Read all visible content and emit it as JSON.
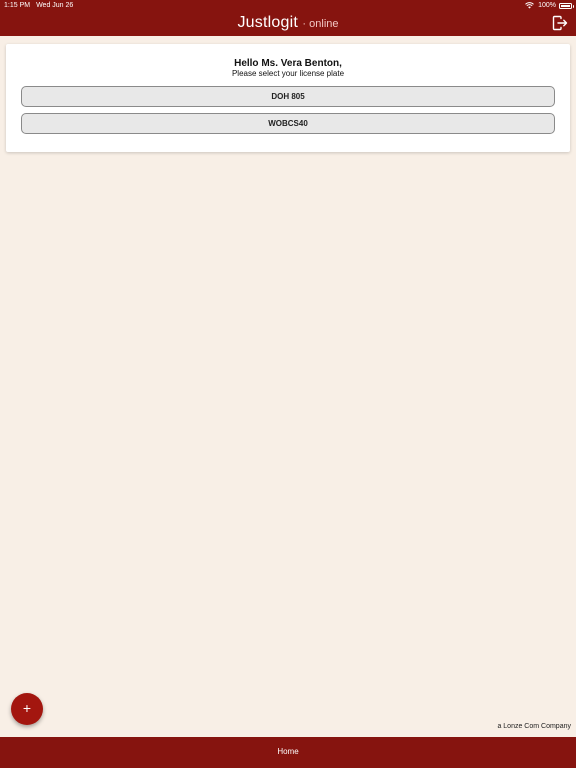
{
  "status_bar": {
    "time": "1:15 PM",
    "date": "Wed Jun 26",
    "battery_percent": "100%",
    "wifi_icon": "wifi-icon",
    "battery_icon": "battery-icon"
  },
  "header": {
    "brand_main": "Justlogit",
    "brand_sub": "online",
    "logout_icon": "logout-icon"
  },
  "card": {
    "greeting": "Hello Ms. Vera Benton,",
    "instruction": "Please select your license plate",
    "plates": [
      "DOH 805",
      "WOBCS40"
    ]
  },
  "company_credit": "a Lonze Com Company",
  "fab": {
    "label": "+",
    "icon": "plus-icon"
  },
  "footer": {
    "home_label": "Home"
  },
  "colors": {
    "brand": "#86140f",
    "background": "#f8efe6",
    "fab": "#a3160f"
  }
}
